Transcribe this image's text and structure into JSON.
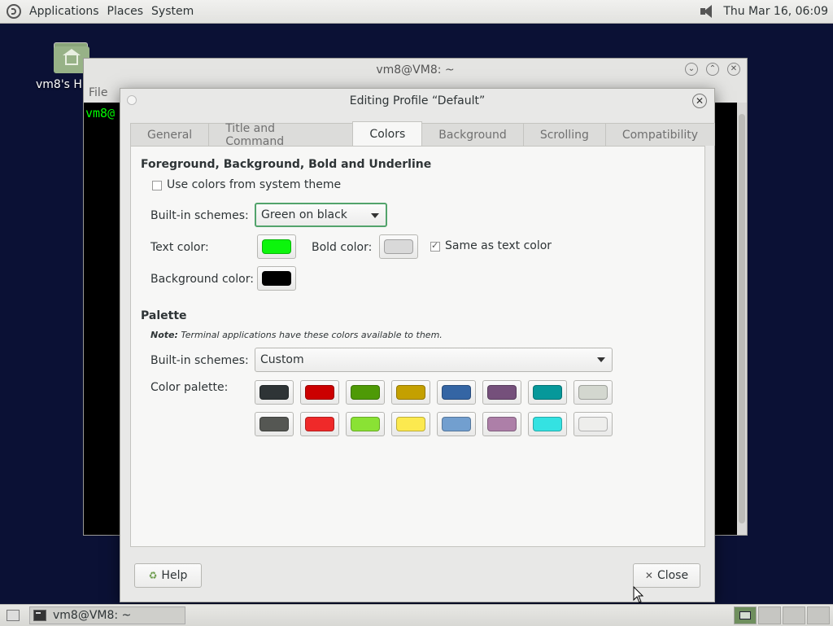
{
  "top_panel": {
    "menus": [
      "Applications",
      "Places",
      "System"
    ],
    "clock": "Thu Mar 16, 06:09"
  },
  "desktop": {
    "home_icon_label": "vm8's H"
  },
  "terminal": {
    "title": "vm8@VM8: ~",
    "menu_file": "File",
    "prompt": "vm8@"
  },
  "dialog": {
    "title": "Editing Profile “Default”",
    "tabs": [
      "General",
      "Title and Command",
      "Colors",
      "Background",
      "Scrolling",
      "Compatibility"
    ],
    "active_tab": "Colors",
    "fg_section": {
      "heading": "Foreground, Background, Bold and Underline",
      "use_system_theme_label": "Use colors from system theme",
      "use_system_theme_checked": false,
      "schemes_label": "Built-in schemes:",
      "schemes_value": "Green on black",
      "text_color_label": "Text color:",
      "text_color": "#0cf50c",
      "bold_color_label": "Bold color:",
      "bold_color": "#d9d9d9",
      "same_as_text_label": "Same as text color",
      "same_as_text_checked": true,
      "background_color_label": "Background color:",
      "background_color": "#000000"
    },
    "palette_section": {
      "heading": "Palette",
      "note_prefix": "Note:",
      "note_text": " Terminal applications have these colors available to them.",
      "schemes_label": "Built-in schemes:",
      "schemes_value": "Custom",
      "palette_label": "Color palette:",
      "colors_row1": [
        "#2e3436",
        "#cc0000",
        "#4e9a06",
        "#c4a000",
        "#3465a4",
        "#75507b",
        "#06989a",
        "#d3d7cf"
      ],
      "colors_row2": [
        "#555753",
        "#ef2929",
        "#8ae234",
        "#fce94f",
        "#729fcf",
        "#ad7fa8",
        "#34e2e2",
        "#eeeeec"
      ]
    },
    "help_label": "Help",
    "close_label": "Close"
  },
  "bottom_panel": {
    "task_label": "vm8@VM8: ~"
  }
}
